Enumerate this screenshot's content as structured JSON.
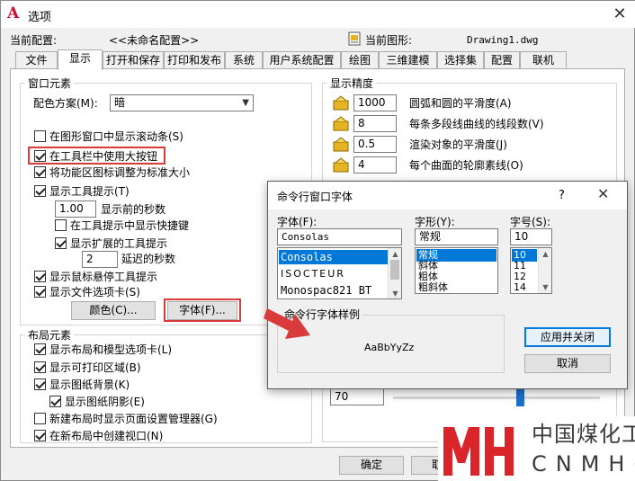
{
  "window": {
    "title": "选项",
    "close": "✕"
  },
  "profile": {
    "label": "当前配置:",
    "value": "<<未命名配置>>",
    "drawing_label": "当前图形:",
    "drawing_value": "Drawing1.dwg"
  },
  "tabs": [
    "文件",
    "显示",
    "打开和保存",
    "打印和发布",
    "系统",
    "用户系统配置",
    "绘图",
    "三维建模",
    "选择集",
    "配置",
    "联机"
  ],
  "window_elements": {
    "title": "窗口元素",
    "color_scheme_label": "配色方案(M):",
    "color_scheme_value": "暗",
    "cb_scrollbars": "在图形窗口中显示滚动条(S)",
    "cb_large_buttons": "在工具栏中使用大按钮",
    "cb_resize_ribbon": "将功能区图标调整为标准大小",
    "cb_tooltips": "显示工具提示(T)",
    "tooltip_delay_value": "1.00",
    "tooltip_delay_label": "显示前的秒数",
    "cb_shortcut": "在工具提示中显示快捷键",
    "cb_extended": "显示扩展的工具提示",
    "extended_delay_value": "2",
    "extended_delay_label": "延迟的秒数",
    "cb_rollover": "显示鼠标悬停工具提示",
    "cb_file_tabs": "显示文件选项卡(S)",
    "colors_button": "颜色(C)...",
    "fonts_button": "字体(F)..."
  },
  "layout_elements": {
    "title": "布局元素",
    "cb_layout_tabs": "显示布局和模型选项卡(L)",
    "cb_printable": "显示可打印区域(B)",
    "cb_paper_bg": "显示图纸背景(K)",
    "cb_paper_shadow": "显示图纸阴影(E)",
    "cb_page_setup": "新建布局时显示页面设置管理器(G)",
    "cb_viewport": "在新布局中创建视口(N)"
  },
  "display_resolution": {
    "title": "显示精度",
    "rows": [
      {
        "value": "1000",
        "label": "圆弧和圆的平滑度(A)"
      },
      {
        "value": "8",
        "label": "每条多段线曲线的线段数(V)"
      },
      {
        "value": "0.5",
        "label": "渲染对象的平滑度(J)"
      },
      {
        "value": "4",
        "label": "每个曲面的轮廓素线(O)"
      }
    ]
  },
  "partial": {
    "field_value": "70"
  },
  "bottom_buttons": {
    "ok": "确定",
    "cancel_partial": "取"
  },
  "dialog": {
    "title": "命令行窗口字体",
    "help": "?",
    "close": "✕",
    "font_label": "字体(F):",
    "font_value": "Consolas",
    "fonts": [
      "Consolas",
      "ISOCTEUR",
      "Monospac821 BT"
    ],
    "style_label": "字形(Y):",
    "style_value": "常规",
    "styles": [
      "常规",
      "斜体",
      "粗体",
      "粗斜体"
    ],
    "size_label": "字号(S):",
    "size_value": "10",
    "sizes": [
      "10",
      "11",
      "12",
      "14"
    ],
    "sample_title": "命令行字体样例",
    "sample_text": "AaBbYyZz",
    "apply_button": "应用并关闭",
    "cancel_button": "取消"
  },
  "watermark": {
    "cn": "中国煤化工",
    "en": "CNMHG"
  },
  "colors": {
    "accent_red": "#d93a3a",
    "selection_blue": "#0078d7",
    "logo_red": "#c8102e",
    "slider_blue": "#1d6fc7"
  }
}
